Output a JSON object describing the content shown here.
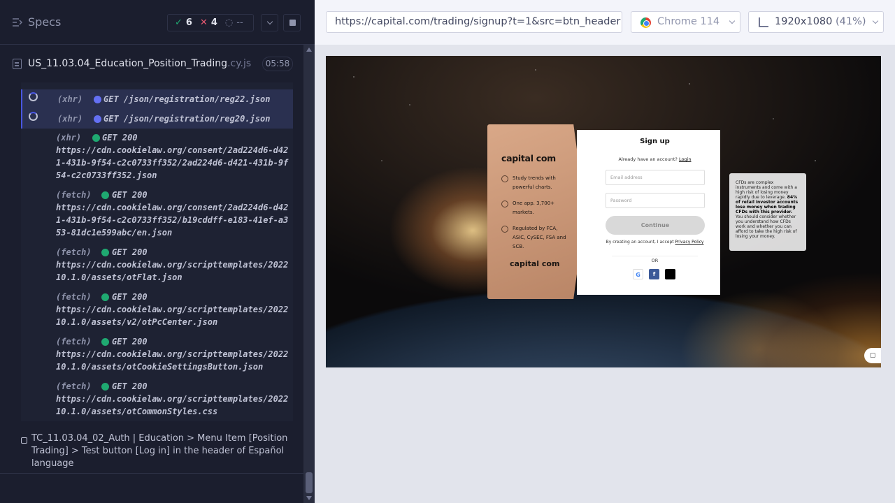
{
  "reporter": {
    "title": "Specs",
    "stats": {
      "passed": "6",
      "failed": "4",
      "pending": "--"
    },
    "spec": {
      "name": "US_11.03.04_Education_Position_Trading",
      "ext": ".cy.js",
      "duration": "05:58"
    },
    "commands": [
      {
        "type": "(xhr)",
        "method": "GET /json/registration/reg22.json",
        "pending": true
      },
      {
        "type": "(xhr)",
        "method": "GET /json/registration/reg20.json",
        "pending": true
      },
      {
        "type": "(xhr)",
        "method": "GET 200",
        "url": "https://cdn.cookielaw.org/consent/2ad224d6-d421-431b-9f54-c2c0733ff352/2ad224d6-d421-431b-9f54-c2c0733ff352.json"
      },
      {
        "type": "(fetch)",
        "method": "GET 200",
        "url": "https://cdn.cookielaw.org/consent/2ad224d6-d421-431b-9f54-c2c0733ff352/b19cddff-e183-41ef-a353-81dc1e599abc/en.json"
      },
      {
        "type": "(fetch)",
        "method": "GET 200",
        "url": "https://cdn.cookielaw.org/scripttemplates/202210.1.0/assets/otFlat.json"
      },
      {
        "type": "(fetch)",
        "method": "GET 200",
        "url": "https://cdn.cookielaw.org/scripttemplates/202210.1.0/assets/v2/otPcCenter.json"
      },
      {
        "type": "(fetch)",
        "method": "GET 200",
        "url": "https://cdn.cookielaw.org/scripttemplates/202210.1.0/assets/otCookieSettingsButton.json"
      },
      {
        "type": "(fetch)",
        "method": "GET 200",
        "url": "https://cdn.cookielaw.org/scripttemplates/202210.1.0/assets/otCommonStyles.css"
      }
    ],
    "test_title": "TC_11.03.04_02_Auth | Education > Menu Item [Position Trading] > Test button [Log in] in the header of Español language"
  },
  "aut_header": {
    "url": "https://capital.com/trading/signup?t=1&src=btn_header",
    "browser": "Chrome 114",
    "viewport": "1920x1080",
    "viewport_scale": "(41%)"
  },
  "aut": {
    "promo": {
      "logo": "capital com",
      "features": [
        "Study trends with powerful charts.",
        "One app. 3,700+ markets.",
        "Regulated by FCA, ASIC, CySEC, FSA and SCB."
      ],
      "logo_bottom": "capital com"
    },
    "form": {
      "title": "Sign up",
      "already": "Already have an account?",
      "login_link": "Login",
      "email_placeholder": "Email address",
      "password_placeholder": "Password",
      "continue": "Continue",
      "terms": "By creating an account, I accept",
      "privacy_link": "Privacy Policy",
      "or": "OR"
    },
    "risk": {
      "part1": "CFDs are complex instruments and come with a high risk of losing money rapidly due to leverage.",
      "bold": "84% of retail investor accounts lose money when trading CFDs with this provider.",
      "part2": "You should consider whether you understand how CFDs work and whether you can afford to take the high risk of losing your money."
    }
  }
}
